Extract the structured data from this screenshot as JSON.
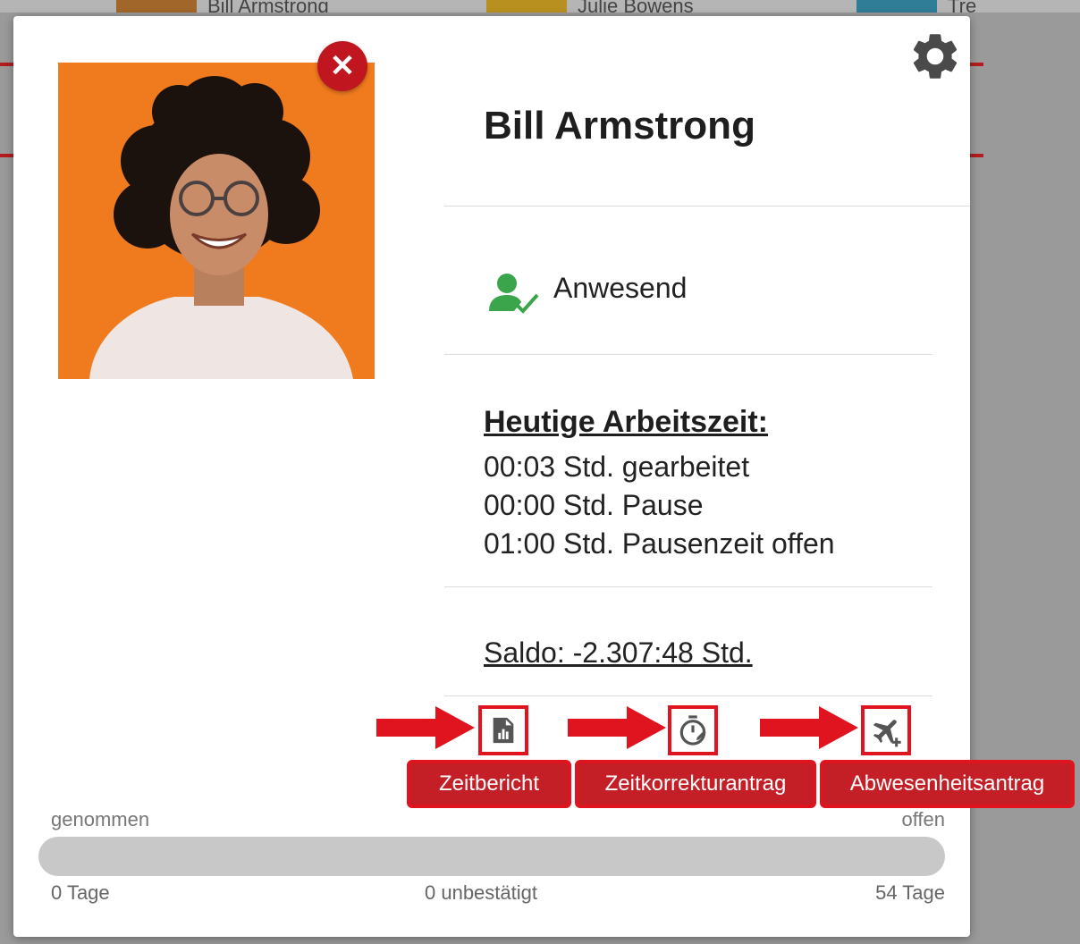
{
  "background": {
    "people": [
      {
        "name": "Bill Armstrong",
        "color": "#c07a2a"
      },
      {
        "name": "Julie Bowens",
        "color": "#d7b020"
      },
      {
        "name": "Tre",
        "color": "#3a9ab8"
      }
    ]
  },
  "employee": {
    "name": "Bill Armstrong",
    "status": "Anwesend"
  },
  "worktime": {
    "title": "Heutige Arbeitszeit:",
    "lines": [
      "00:03 Std. gearbeitet",
      "00:00 Std. Pause",
      "01:00 Std. Pausenzeit offen"
    ],
    "saldo": "Saldo: -2.307:48 Std."
  },
  "actions": [
    {
      "label": "Zeitbericht",
      "icon": "report-icon"
    },
    {
      "label": "Zeitkorrekturantrag",
      "icon": "stopwatch-icon"
    },
    {
      "label": "Abwesenheitsantrag",
      "icon": "flight-add-icon"
    }
  ],
  "vacation": {
    "left_label": "genommen",
    "right_label": "offen",
    "taken": "0 Tage",
    "unconfirmed": "0 unbestätigt",
    "open": "54 Tage"
  },
  "colors": {
    "accent_red": "#c0161f",
    "status_green": "#3aa54a",
    "photo_bg": "#f07a1e"
  }
}
